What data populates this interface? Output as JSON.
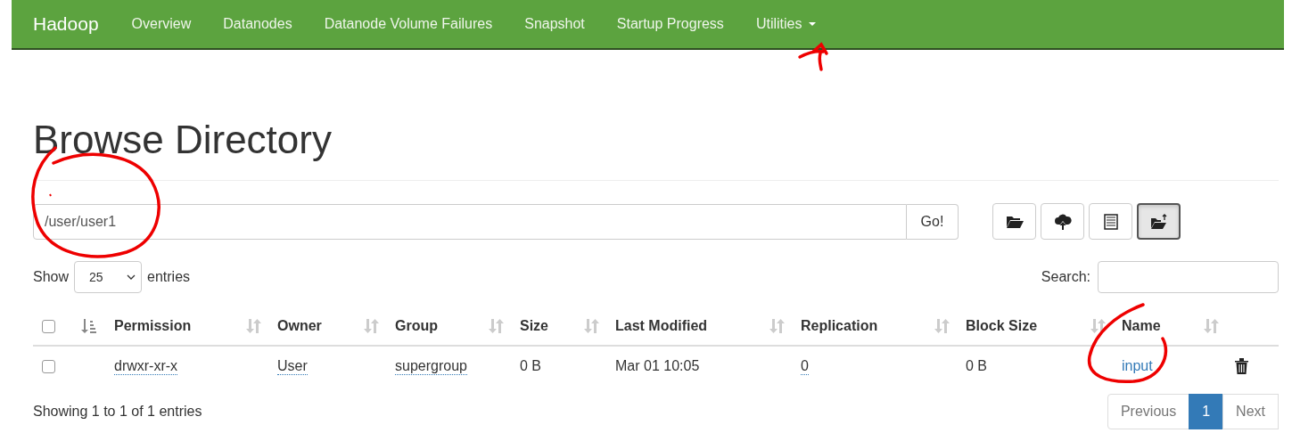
{
  "navbar": {
    "brand": "Hadoop",
    "items": [
      {
        "label": "Overview",
        "dropdown": false
      },
      {
        "label": "Datanodes",
        "dropdown": false
      },
      {
        "label": "Datanode Volume Failures",
        "dropdown": false
      },
      {
        "label": "Snapshot",
        "dropdown": false
      },
      {
        "label": "Startup Progress",
        "dropdown": false
      },
      {
        "label": "Utilities",
        "dropdown": true
      }
    ]
  },
  "title": "Browse Directory",
  "path_field": {
    "value": "/user/user1"
  },
  "go_button": "Go!",
  "toolbar": [
    {
      "kind": "folder",
      "selected": false
    },
    {
      "kind": "upload",
      "selected": false
    },
    {
      "kind": "list",
      "selected": false
    },
    {
      "kind": "new-folder",
      "selected": true
    }
  ],
  "show_entries": {
    "before": "Show",
    "value": "25",
    "after": "entries"
  },
  "search": {
    "label": "Search:"
  },
  "table": {
    "select_all": {
      "checked": false
    },
    "columns": [
      "Permission",
      "Owner",
      "Group",
      "Size",
      "Last Modified",
      "Replication",
      "Block Size",
      "Name"
    ],
    "rows": [
      {
        "checked": false,
        "cells": [
          {
            "text": "drwxr-xr-x",
            "kind": "abbr"
          },
          {
            "text": "User",
            "kind": "abbr"
          },
          {
            "text": "supergroup",
            "kind": "abbr"
          },
          {
            "text": "0 B",
            "kind": "plain"
          },
          {
            "text": "Mar 01 10:05",
            "kind": "plain"
          },
          {
            "text": "0",
            "kind": "abbr"
          },
          {
            "text": "0 B",
            "kind": "plain"
          },
          {
            "text": "input",
            "kind": "link"
          }
        ]
      }
    ]
  },
  "info": "Showing 1 to 1 of 1 entries",
  "pagination": [
    {
      "label": "Previous",
      "selected": false
    },
    {
      "label": "1",
      "selected": true
    },
    {
      "label": "Next",
      "selected": false
    }
  ]
}
